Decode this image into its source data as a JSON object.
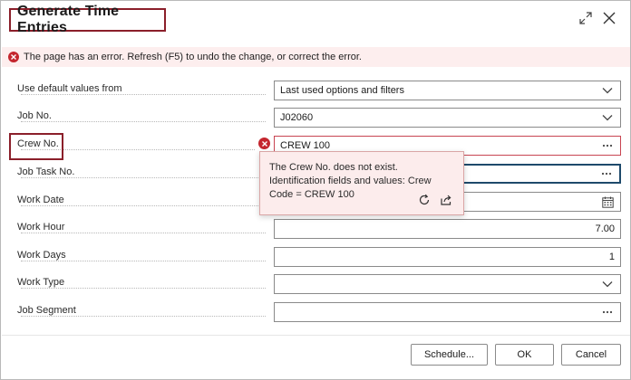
{
  "dialog": {
    "title": "Generate Time Entries",
    "icons": {
      "expand": "expand-icon",
      "close": "close-icon"
    }
  },
  "error_banner": {
    "message": "The page has an error. Refresh (F5) to undo the change, or correct the error.",
    "color": "#c4262e"
  },
  "fields": [
    {
      "label": "Use default values from",
      "value": "Last used options and filters",
      "control": "dropdown"
    },
    {
      "label": "Job No.",
      "value": "J02060",
      "control": "dropdown"
    },
    {
      "label": "Crew No.",
      "value": "CREW 100",
      "control": "lookup",
      "state": "error"
    },
    {
      "label": "Job Task No.",
      "value": "",
      "control": "lookup",
      "state": "focused"
    },
    {
      "label": "Work Date",
      "value": "",
      "control": "calendar"
    },
    {
      "label": "Work Hour",
      "value": "7.00",
      "control": "none"
    },
    {
      "label": "Work Days",
      "value": "1",
      "control": "none"
    },
    {
      "label": "Work Type",
      "value": "",
      "control": "dropdown"
    },
    {
      "label": "Job Segment",
      "value": "",
      "control": "lookup"
    }
  ],
  "tooltip": {
    "message": "The Crew No. does not exist. Identification fields and values: Crew Code = CREW 100",
    "icons": {
      "refresh": "refresh-icon",
      "share": "share-icon"
    }
  },
  "buttons": {
    "schedule": "Schedule...",
    "ok": "OK",
    "cancel": "Cancel"
  },
  "colors": {
    "highlight_border": "#8b1f2a",
    "error_background": "#fdeeee",
    "focus_border": "#1e4a6b"
  }
}
